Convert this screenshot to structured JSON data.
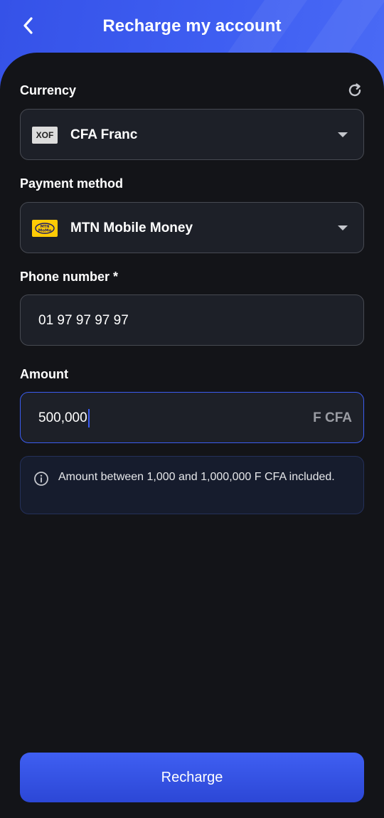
{
  "header": {
    "title": "Recharge my account"
  },
  "currency": {
    "label": "Currency",
    "badge": "XOF",
    "selected": "CFA Franc"
  },
  "payment": {
    "label": "Payment method",
    "logo_text_top": "MTN",
    "logo_text_bottom": "MoMo",
    "selected": "MTN Mobile Money"
  },
  "phone": {
    "label": "Phone number *",
    "value": "01 97 97 97 97"
  },
  "amount": {
    "label": "Amount",
    "value": "500,000",
    "unit": "F CFA"
  },
  "info": {
    "text": "Amount between 1,000 and 1,000,000 F CFA included."
  },
  "actions": {
    "recharge_label": "Recharge"
  },
  "colors": {
    "accent": "#3b5cf0",
    "background": "#131418",
    "field": "#1d2028",
    "momo_yellow": "#ffcb05"
  }
}
